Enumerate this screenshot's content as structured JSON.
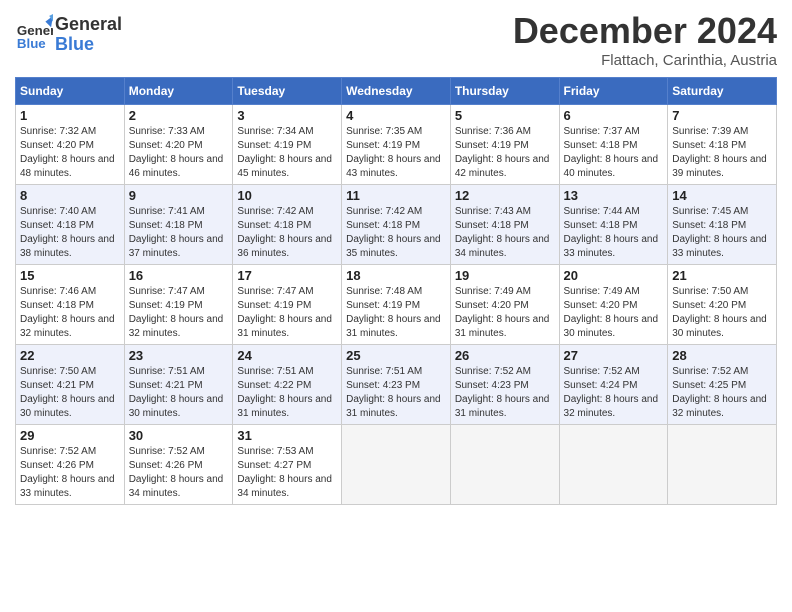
{
  "header": {
    "logo_line1": "General",
    "logo_line2": "Blue",
    "month_title": "December 2024",
    "location": "Flattach, Carinthia, Austria"
  },
  "days_of_week": [
    "Sunday",
    "Monday",
    "Tuesday",
    "Wednesday",
    "Thursday",
    "Friday",
    "Saturday"
  ],
  "weeks": [
    [
      {
        "day": 1,
        "sunrise": "7:32 AM",
        "sunset": "4:20 PM",
        "daylight": "8 hours and 48 minutes."
      },
      {
        "day": 2,
        "sunrise": "7:33 AM",
        "sunset": "4:20 PM",
        "daylight": "8 hours and 46 minutes."
      },
      {
        "day": 3,
        "sunrise": "7:34 AM",
        "sunset": "4:19 PM",
        "daylight": "8 hours and 45 minutes."
      },
      {
        "day": 4,
        "sunrise": "7:35 AM",
        "sunset": "4:19 PM",
        "daylight": "8 hours and 43 minutes."
      },
      {
        "day": 5,
        "sunrise": "7:36 AM",
        "sunset": "4:19 PM",
        "daylight": "8 hours and 42 minutes."
      },
      {
        "day": 6,
        "sunrise": "7:37 AM",
        "sunset": "4:18 PM",
        "daylight": "8 hours and 40 minutes."
      },
      {
        "day": 7,
        "sunrise": "7:39 AM",
        "sunset": "4:18 PM",
        "daylight": "8 hours and 39 minutes."
      }
    ],
    [
      {
        "day": 8,
        "sunrise": "7:40 AM",
        "sunset": "4:18 PM",
        "daylight": "8 hours and 38 minutes."
      },
      {
        "day": 9,
        "sunrise": "7:41 AM",
        "sunset": "4:18 PM",
        "daylight": "8 hours and 37 minutes."
      },
      {
        "day": 10,
        "sunrise": "7:42 AM",
        "sunset": "4:18 PM",
        "daylight": "8 hours and 36 minutes."
      },
      {
        "day": 11,
        "sunrise": "7:42 AM",
        "sunset": "4:18 PM",
        "daylight": "8 hours and 35 minutes."
      },
      {
        "day": 12,
        "sunrise": "7:43 AM",
        "sunset": "4:18 PM",
        "daylight": "8 hours and 34 minutes."
      },
      {
        "day": 13,
        "sunrise": "7:44 AM",
        "sunset": "4:18 PM",
        "daylight": "8 hours and 33 minutes."
      },
      {
        "day": 14,
        "sunrise": "7:45 AM",
        "sunset": "4:18 PM",
        "daylight": "8 hours and 33 minutes."
      }
    ],
    [
      {
        "day": 15,
        "sunrise": "7:46 AM",
        "sunset": "4:18 PM",
        "daylight": "8 hours and 32 minutes."
      },
      {
        "day": 16,
        "sunrise": "7:47 AM",
        "sunset": "4:19 PM",
        "daylight": "8 hours and 32 minutes."
      },
      {
        "day": 17,
        "sunrise": "7:47 AM",
        "sunset": "4:19 PM",
        "daylight": "8 hours and 31 minutes."
      },
      {
        "day": 18,
        "sunrise": "7:48 AM",
        "sunset": "4:19 PM",
        "daylight": "8 hours and 31 minutes."
      },
      {
        "day": 19,
        "sunrise": "7:49 AM",
        "sunset": "4:20 PM",
        "daylight": "8 hours and 31 minutes."
      },
      {
        "day": 20,
        "sunrise": "7:49 AM",
        "sunset": "4:20 PM",
        "daylight": "8 hours and 30 minutes."
      },
      {
        "day": 21,
        "sunrise": "7:50 AM",
        "sunset": "4:20 PM",
        "daylight": "8 hours and 30 minutes."
      }
    ],
    [
      {
        "day": 22,
        "sunrise": "7:50 AM",
        "sunset": "4:21 PM",
        "daylight": "8 hours and 30 minutes."
      },
      {
        "day": 23,
        "sunrise": "7:51 AM",
        "sunset": "4:21 PM",
        "daylight": "8 hours and 30 minutes."
      },
      {
        "day": 24,
        "sunrise": "7:51 AM",
        "sunset": "4:22 PM",
        "daylight": "8 hours and 31 minutes."
      },
      {
        "day": 25,
        "sunrise": "7:51 AM",
        "sunset": "4:23 PM",
        "daylight": "8 hours and 31 minutes."
      },
      {
        "day": 26,
        "sunrise": "7:52 AM",
        "sunset": "4:23 PM",
        "daylight": "8 hours and 31 minutes."
      },
      {
        "day": 27,
        "sunrise": "7:52 AM",
        "sunset": "4:24 PM",
        "daylight": "8 hours and 32 minutes."
      },
      {
        "day": 28,
        "sunrise": "7:52 AM",
        "sunset": "4:25 PM",
        "daylight": "8 hours and 32 minutes."
      }
    ],
    [
      {
        "day": 29,
        "sunrise": "7:52 AM",
        "sunset": "4:26 PM",
        "daylight": "8 hours and 33 minutes."
      },
      {
        "day": 30,
        "sunrise": "7:52 AM",
        "sunset": "4:26 PM",
        "daylight": "8 hours and 34 minutes."
      },
      {
        "day": 31,
        "sunrise": "7:53 AM",
        "sunset": "4:27 PM",
        "daylight": "8 hours and 34 minutes."
      },
      null,
      null,
      null,
      null
    ]
  ],
  "labels": {
    "sunrise": "Sunrise:",
    "sunset": "Sunset:",
    "daylight": "Daylight:"
  }
}
